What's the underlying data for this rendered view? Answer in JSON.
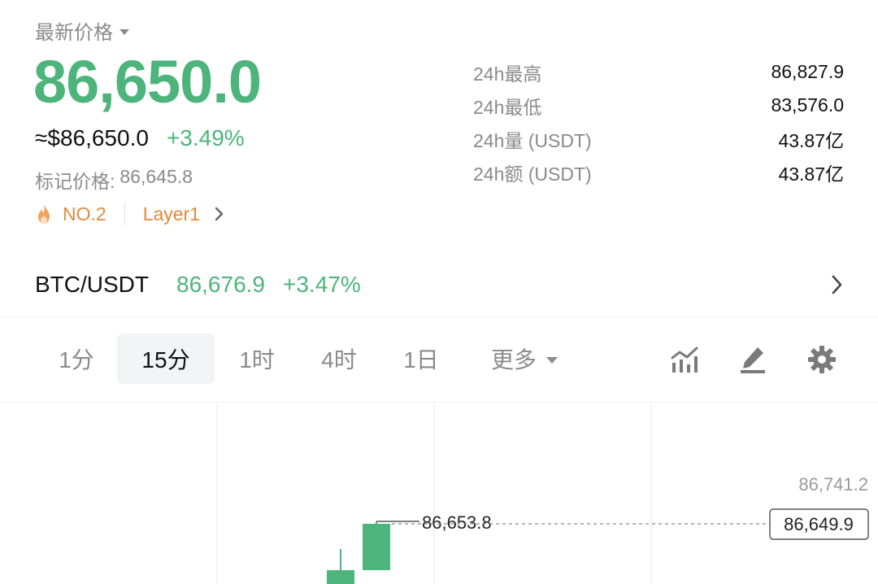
{
  "header": {
    "price_label": "最新价格",
    "last_price": "86,650.0",
    "usd_price": "≈$86,650.0",
    "change_pct": "+3.49%",
    "mark_price_label": "标记价格:",
    "mark_price": "86,645.8",
    "rank_tag": "NO.2",
    "category_tag": "Layer1"
  },
  "stats": [
    {
      "label": "24h最高",
      "value": "86,827.9"
    },
    {
      "label": "24h最低",
      "value": "83,576.0"
    },
    {
      "label": "24h量 (USDT)",
      "value": "43.87亿"
    },
    {
      "label": "24h额 (USDT)",
      "value": "43.87亿"
    }
  ],
  "pair": {
    "symbol": "BTC/USDT",
    "price": "86,676.9",
    "change": "+3.47%"
  },
  "tabs": {
    "items": [
      "1分",
      "15分",
      "1时",
      "4时",
      "1日"
    ],
    "active_index": 1,
    "more": "更多"
  },
  "chart": {
    "axis_top": "86,741.2",
    "high_marker": "86,653.8",
    "current_price": "86,649.9"
  },
  "colors": {
    "up": "#4db47b",
    "text_gray": "#8a8a8a",
    "tag_orange": "#e08a3c",
    "icon_gray": "#7a7a7a"
  },
  "icons": {
    "price_caret": "caret-down-icon",
    "rank": "fire-icon",
    "tag_chevron": "chevron-right-icon",
    "pair_chevron": "chevron-right-icon",
    "indicator": "indicator-chart-icon",
    "draw": "pencil-icon",
    "settings": "gear-icon"
  }
}
